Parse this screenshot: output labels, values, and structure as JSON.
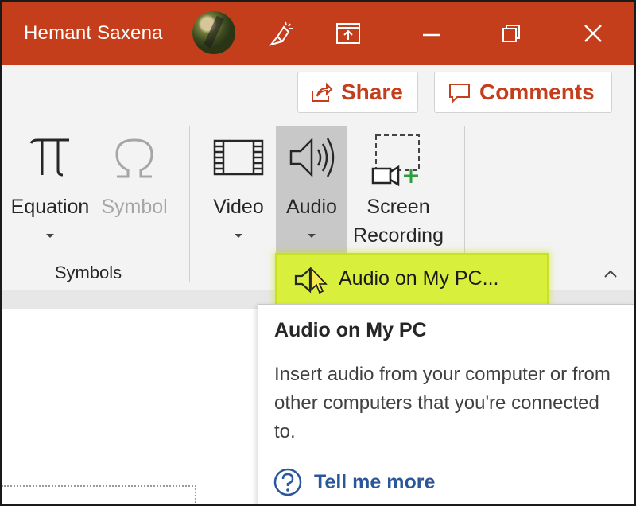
{
  "titlebar": {
    "user_name": "Hemant Saxena",
    "accent_color": "#c43e1c",
    "icons": [
      "avatar",
      "coauthor-icon",
      "ribbon-display-icon",
      "minimize-icon",
      "restore-icon",
      "close-icon"
    ]
  },
  "ribbon": {
    "share_label": "Share",
    "comments_label": "Comments",
    "commands": {
      "equation": "Equation",
      "symbol": "Symbol",
      "video": "Video",
      "audio": "Audio",
      "screen_recording_line1": "Screen",
      "screen_recording_line2": "Recording"
    },
    "group_label": "Symbols"
  },
  "dropdown": {
    "item_label": "Audio on My PC...",
    "highlight_color": "#d8f03c"
  },
  "tooltip": {
    "title": "Audio on My PC",
    "description": "Insert audio from your computer or from other computers that you're connected to.",
    "link_label": "Tell me more",
    "link_color": "#2b579a"
  }
}
